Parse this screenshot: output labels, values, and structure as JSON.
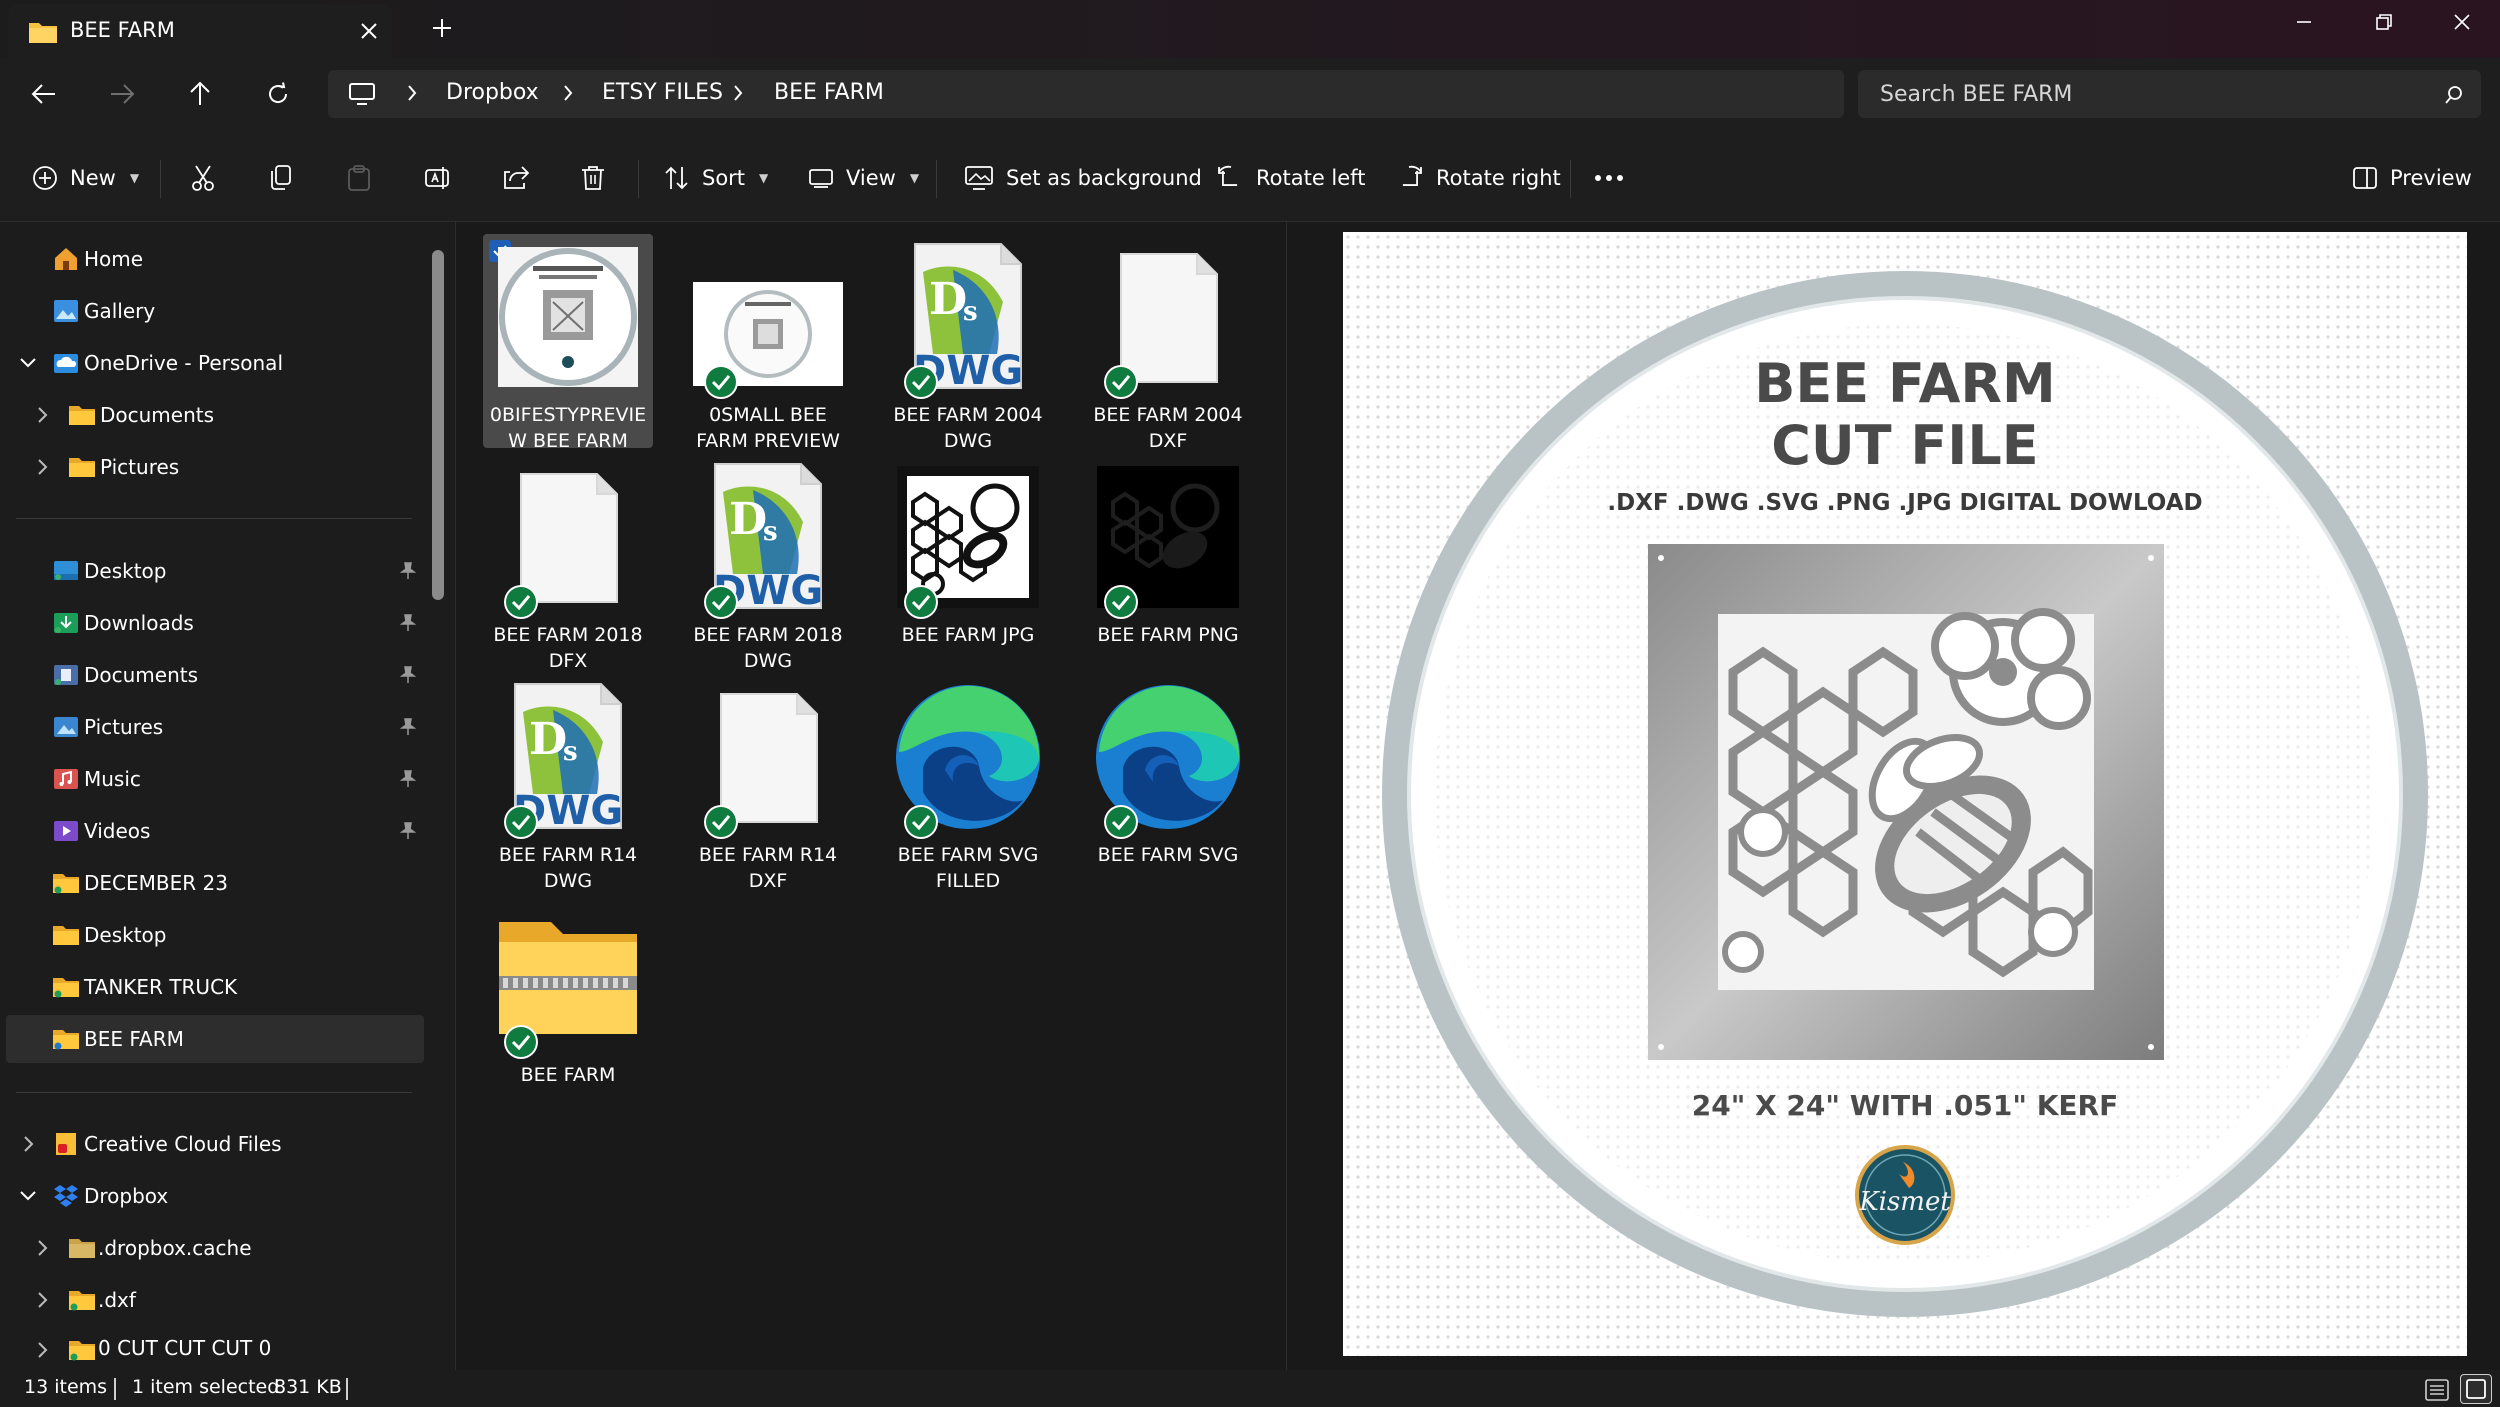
{
  "window": {
    "tab_title": "BEE FARM"
  },
  "breadcrumb": [
    "Dropbox",
    "ETSY FILES",
    "BEE FARM"
  ],
  "search": {
    "placeholder": "Search BEE FARM"
  },
  "toolbar": {
    "new_label": "New",
    "sort_label": "Sort",
    "view_label": "View",
    "set_background_label": "Set as background",
    "rotate_left_label": "Rotate left",
    "rotate_right_label": "Rotate right",
    "preview_label": "Preview"
  },
  "sidebar": {
    "items": [
      {
        "label": "Home",
        "icon": "home-icon"
      },
      {
        "label": "Gallery",
        "icon": "gallery-icon"
      },
      {
        "label": "OneDrive - Personal",
        "icon": "onedrive-icon"
      },
      {
        "label": "Documents",
        "icon": "folder-icon"
      },
      {
        "label": "Pictures",
        "icon": "folder-icon"
      },
      {
        "label": "Desktop",
        "icon": "desktop-icon"
      },
      {
        "label": "Downloads",
        "icon": "downloads-icon"
      },
      {
        "label": "Documents",
        "icon": "documents-icon"
      },
      {
        "label": "Pictures",
        "icon": "pictures-icon"
      },
      {
        "label": "Music",
        "icon": "music-icon"
      },
      {
        "label": "Videos",
        "icon": "videos-icon"
      },
      {
        "label": "DECEMBER 23",
        "icon": "folder-icon"
      },
      {
        "label": "Desktop",
        "icon": "folder-icon"
      },
      {
        "label": "TANKER TRUCK",
        "icon": "folder-icon"
      },
      {
        "label": "BEE FARM",
        "icon": "folder-icon"
      },
      {
        "label": "Creative Cloud Files",
        "icon": "creative-cloud-icon"
      },
      {
        "label": "Dropbox",
        "icon": "dropbox-icon"
      },
      {
        "label": ".dropbox.cache",
        "icon": "folder-icon"
      },
      {
        "label": ".dxf",
        "icon": "folder-icon"
      },
      {
        "label": "0 CUT CUT CUT 0",
        "icon": "folder-icon"
      }
    ]
  },
  "files": [
    {
      "name": "0BIFESTYPREVIEW BEE FARM",
      "type": "image-preview"
    },
    {
      "name": "0SMALL BEE FARM PREVIEW",
      "type": "image-small"
    },
    {
      "name": "BEE FARM 2004 DWG",
      "type": "dwg"
    },
    {
      "name": "BEE FARM 2004 DXF",
      "type": "blank"
    },
    {
      "name": "BEE FARM 2018 DFX",
      "type": "blank"
    },
    {
      "name": "BEE FARM 2018 DWG",
      "type": "dwg"
    },
    {
      "name": "BEE FARM JPG",
      "type": "jpg"
    },
    {
      "name": "BEE FARM PNG",
      "type": "png"
    },
    {
      "name": "BEE FARM R14 DWG",
      "type": "dwg"
    },
    {
      "name": "BEE FARM R14 DXF",
      "type": "blank"
    },
    {
      "name": "BEE FARM SVG FILLED",
      "type": "edge"
    },
    {
      "name": "BEE FARM SVG",
      "type": "edge"
    },
    {
      "name": "BEE FARM",
      "type": "zip"
    }
  ],
  "preview": {
    "title_line1": "BEE FARM",
    "title_line2": "CUT FILE",
    "formats": ".DXF .DWG .SVG .PNG .JPG DIGITAL DOWLOAD",
    "size_text": "24\" X 24\" WITH .051\" KERF",
    "logo_text": "Kismet"
  },
  "dwg_text": "DWG",
  "status": {
    "items_count": "13 items",
    "selected": "1 item selected",
    "size": "831 KB"
  },
  "colors": {
    "accent": "#1e5fb5",
    "folder": "#f5c242",
    "check": "#0f7b3e"
  }
}
